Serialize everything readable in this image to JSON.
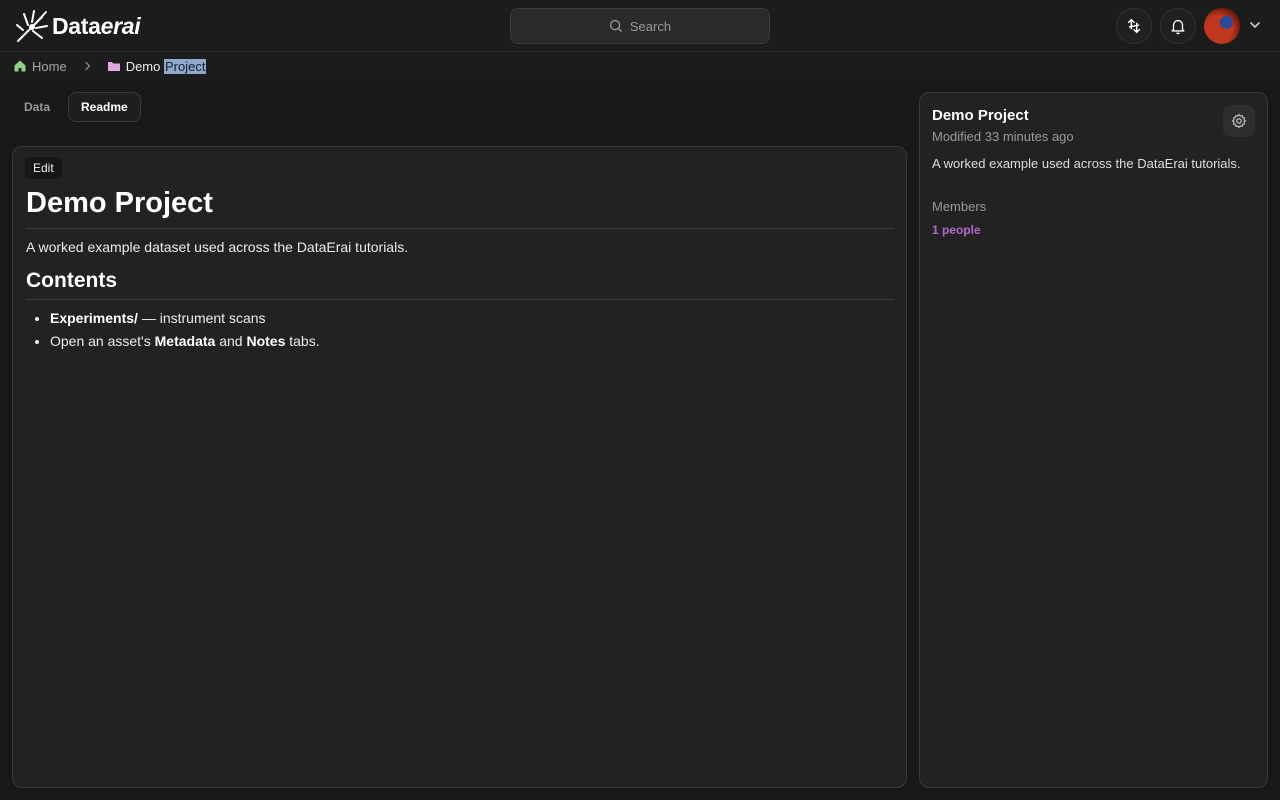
{
  "app": {
    "logo_text_plain": "Data",
    "logo_text_italic": "erai"
  },
  "search": {
    "placeholder": "Search"
  },
  "breadcrumb": {
    "home": "Home",
    "current_plain": "Demo ",
    "current_selected": "Project"
  },
  "tabs": [
    {
      "label": "Data",
      "active": false
    },
    {
      "label": "Readme",
      "active": true
    }
  ],
  "readme": {
    "edit_label": "Edit",
    "title": "Demo Project",
    "intro": "A worked example dataset used across the DataErai tutorials.",
    "contents_heading": "Contents",
    "item1_bold": "Experiments/",
    "item1_rest": " — instrument scans",
    "item2_pre": "Open an asset's ",
    "item2_bold1": "Metadata",
    "item2_mid": " and ",
    "item2_bold2": "Notes",
    "item2_post": " tabs."
  },
  "sidebar": {
    "title": "Demo Project",
    "modified": "Modified 33 minutes ago",
    "description": "A worked example used across the DataErai tutorials.",
    "members_label": "Members",
    "members_count": "1 people"
  },
  "colors": {
    "accent_purple": "#b368c9",
    "home_icon_green": "#8fd18a",
    "folder_icon_pink": "#e0a8e0",
    "selection_highlight": "#8fa8cc"
  },
  "icons": [
    "logo-mark-icon",
    "search-icon",
    "sync-icon",
    "bell-icon",
    "chevron-down-icon",
    "home-icon",
    "chevron-right-icon",
    "folder-icon",
    "gear-icon"
  ]
}
